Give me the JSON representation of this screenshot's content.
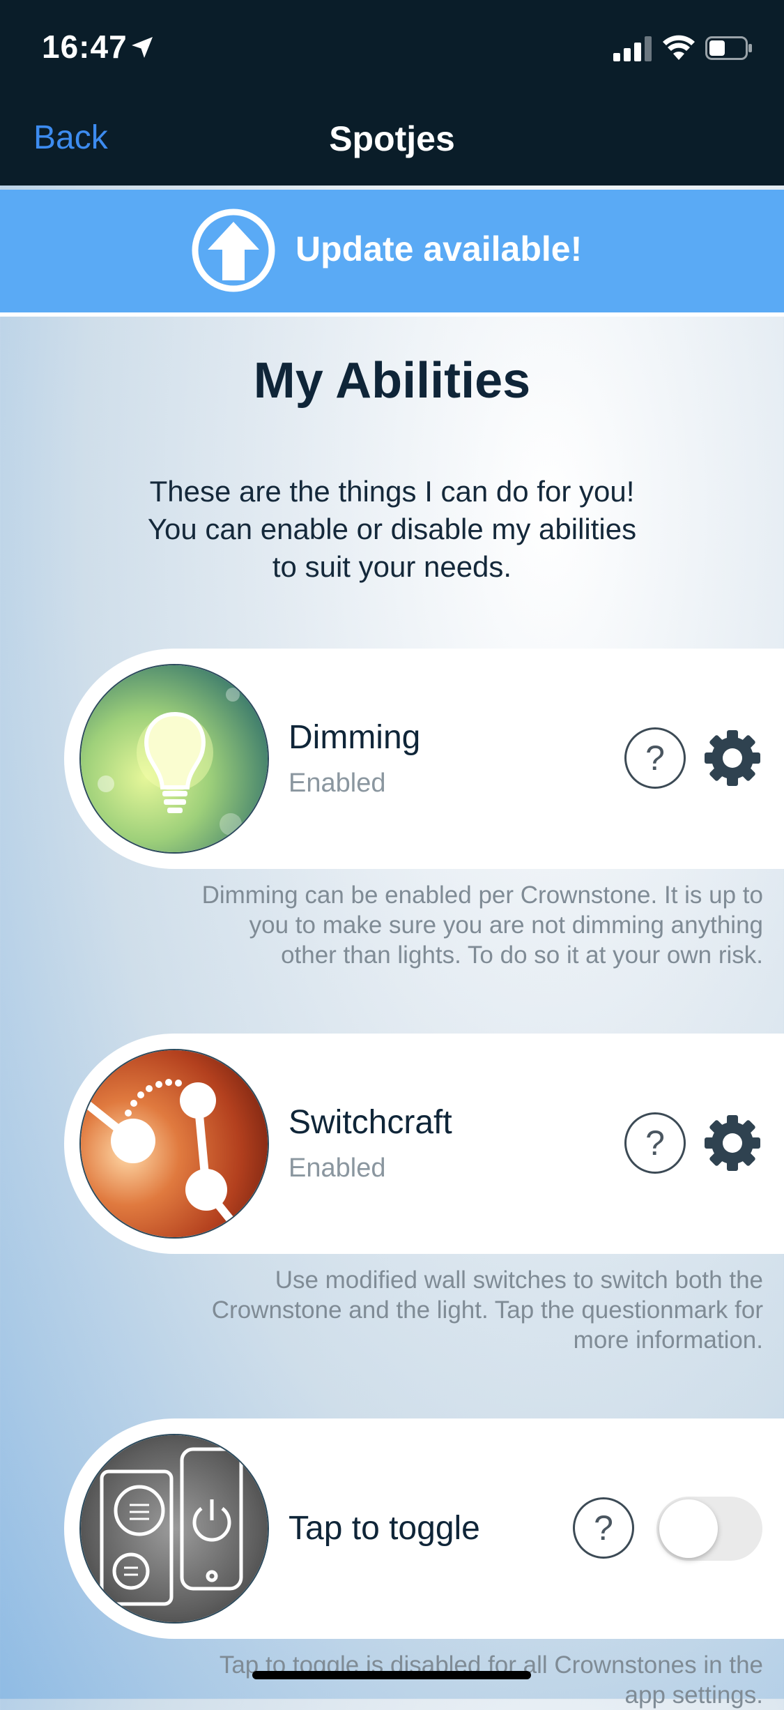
{
  "status_bar": {
    "time": "16:47"
  },
  "nav": {
    "back_label": "Back",
    "title": "Spotjes"
  },
  "update_banner": {
    "text": "Update available!"
  },
  "main": {
    "title": "My Abilities",
    "intro_lines": [
      "These are the things I can do for you!",
      "You can enable or disable my abilities",
      "to suit your needs."
    ]
  },
  "abilities": [
    {
      "name": "Dimming",
      "state": "Enabled",
      "help_label": "?",
      "description_lines": [
        "Dimming can be enabled per Crownstone. It is up to",
        "you to make sure you are not dimming anything",
        "other than lights. To do so it at your own risk."
      ]
    },
    {
      "name": "Switchcraft",
      "state": "Enabled",
      "help_label": "?",
      "description_lines": [
        "Use modified wall switches to switch both the",
        "Crownstone and the light. Tap the questionmark for",
        "more information."
      ]
    },
    {
      "name": "Tap to toggle",
      "help_label": "?",
      "toggle_on": false,
      "description_lines": [
        "Tap to toggle is disabled for all Crownstones in the",
        "app settings."
      ]
    }
  ],
  "colors": {
    "header_bg": "#0a1d29",
    "accent_blue": "#3d8cf0",
    "banner_bg": "#5aaaf5"
  }
}
